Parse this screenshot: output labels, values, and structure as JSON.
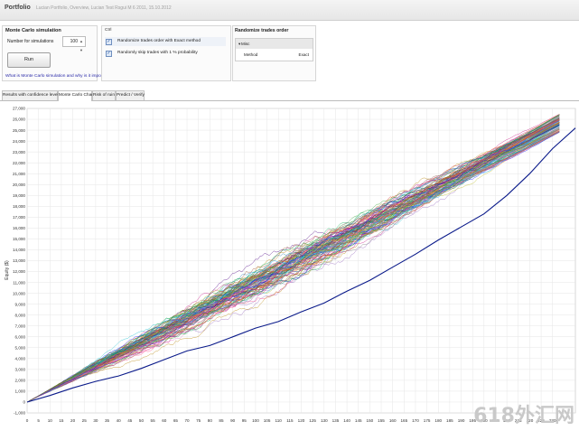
{
  "window": {
    "title": "Portfolio",
    "subtitle": "Lucian Portfolio, Overview, Lucian Test Rsgui M 6 2011, 15.10.2012"
  },
  "monte_carlo": {
    "title": "Monte Carlo simulation",
    "num_simulations_label": "Number for simulations",
    "num_simulations_value": "100",
    "run_label": "Run",
    "help_link": "What is Monte Carlo simulation and why is it important?"
  },
  "options": {
    "header": "Ctrl",
    "items": [
      {
        "label": "Randomize trades order with Exact method",
        "checked": true
      },
      {
        "label": "Randomly skip trades with 1 % probability",
        "checked": true
      }
    ]
  },
  "randomize_trades": {
    "title": "Randomize trades order",
    "group_label": "Misc",
    "row_key": "Method",
    "row_value": "Exact"
  },
  "tabs": [
    {
      "label": "Results with confidence levels",
      "active": false
    },
    {
      "label": "Monte Carlo Chart",
      "active": true
    },
    {
      "label": "Risk of ruin",
      "active": false
    },
    {
      "label": "Predict / Verify",
      "active": false
    }
  ],
  "chart_data": {
    "type": "line",
    "title": "",
    "xlabel": "",
    "ylabel": "Equity ($)",
    "ylim": [
      -1000,
      27000
    ],
    "xlim": [
      0,
      240
    ],
    "y_ticks": [
      "-1,000",
      "0",
      "1,000",
      "2,000",
      "3,000",
      "4,000",
      "5,000",
      "6,000",
      "7,000",
      "8,000",
      "9,000",
      "10,000",
      "11,000",
      "12,000",
      "13,000",
      "14,000",
      "15,000",
      "16,000",
      "17,000",
      "18,000",
      "19,000",
      "20,000",
      "21,000",
      "22,000",
      "23,000",
      "24,000",
      "25,000",
      "26,000",
      "27,000"
    ],
    "x_ticks": [
      "0",
      "5",
      "10",
      "15",
      "20",
      "25",
      "30",
      "35",
      "40",
      "45",
      "50",
      "55",
      "60",
      "65",
      "70",
      "75",
      "80",
      "85",
      "90",
      "95",
      "100",
      "105",
      "110",
      "115",
      "120",
      "125",
      "130",
      "135",
      "140",
      "145",
      "150",
      "155",
      "160",
      "165",
      "170",
      "175",
      "180",
      "185",
      "190",
      "195",
      "200",
      "205",
      "210",
      "215",
      "220",
      "225",
      "230"
    ],
    "grid": true,
    "num_simulations": 100,
    "series_summary": {
      "start_equity": 0,
      "end_equity_min": 24800,
      "end_equity_max": 26500
    },
    "highlight_series": {
      "x": [
        0,
        10,
        20,
        30,
        40,
        50,
        60,
        70,
        80,
        90,
        100,
        110,
        120,
        130,
        140,
        150,
        160,
        170,
        180,
        190,
        200,
        210,
        220,
        230,
        240
      ],
      "y": [
        0,
        600,
        1300,
        1900,
        2400,
        3100,
        3900,
        4700,
        5200,
        6000,
        6800,
        7400,
        8300,
        9100,
        10200,
        11200,
        12400,
        13600,
        14900,
        16100,
        17300,
        19000,
        21000,
        23300,
        25200
      ]
    },
    "watermark": "618外汇网"
  }
}
